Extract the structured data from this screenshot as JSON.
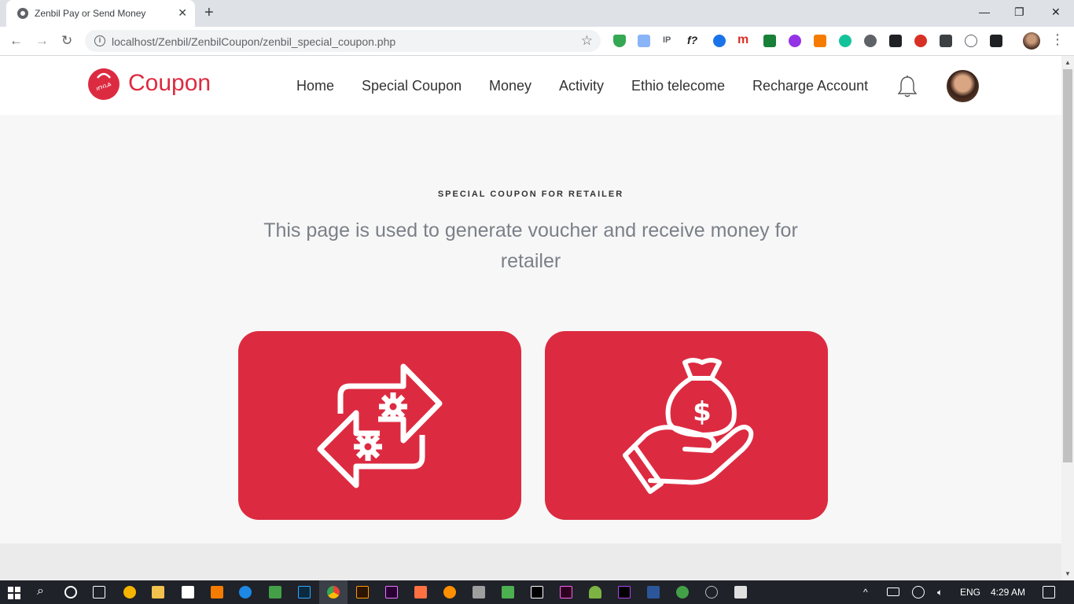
{
  "browser": {
    "tab_title": "Zenbil Pay or Send Money",
    "tab_close": "✕",
    "new_tab": "+",
    "url": "localhost/Zenbil/ZenbilCoupon/zenbil_special_coupon.php",
    "window_controls": {
      "minimize": "—",
      "restore": "❐",
      "close": "✕"
    },
    "nav": {
      "back": "←",
      "forward": "→",
      "reload": "↻"
    },
    "extensions": [
      "shield-icon",
      "screen-icon",
      "ip-icon",
      "f?-icon",
      "a-icon",
      "m-icon",
      "flag-icon",
      "purple-icon",
      "orange-icon",
      "grammarly-icon",
      "ball-icon",
      "black-1-icon",
      "red-icon",
      "db-icon",
      "code-icon",
      "box-icon"
    ]
  },
  "header": {
    "logo_text": "Coupon",
    "logo_badge_text": "ዘንቢል",
    "nav": [
      "Home",
      "Special Coupon",
      "Money",
      "Activity",
      "Ethio telecome",
      "Recharge Account"
    ]
  },
  "main": {
    "eyebrow": "SPECIAL COUPON FOR RETAILER",
    "lead": "This page is used to generate voucher and receive money for retailer",
    "cards": [
      {
        "name": "voucher-exchange-card",
        "icon": "exchange-gears-icon"
      },
      {
        "name": "receive-money-card",
        "icon": "hand-money-bag-icon"
      }
    ]
  },
  "colors": {
    "brand": "#dc2b41",
    "page_bg": "#f7f7f7",
    "lead_text": "#7b8088"
  },
  "taskbar": {
    "language": "ENG",
    "time": "4:29 AM"
  }
}
